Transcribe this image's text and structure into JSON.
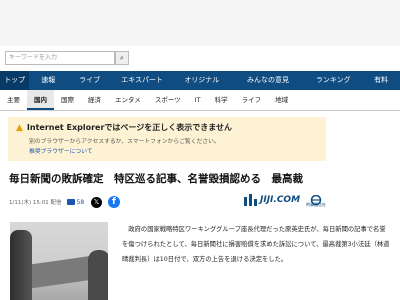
{
  "search": {
    "placeholder": "キーワードを入力",
    "button_icon": "search-icon"
  },
  "nav": {
    "items": [
      "トップ",
      "速報",
      "ライブ",
      "エキスパート",
      "オリジナル",
      "みんなの意見",
      "ランキング",
      "有料"
    ]
  },
  "subnav": {
    "items": [
      "主要",
      "国内",
      "国際",
      "経済",
      "エンタメ",
      "スポーツ",
      "IT",
      "科学",
      "ライフ",
      "地域"
    ],
    "active": "国内"
  },
  "ie_notice": {
    "title": "Internet Explorerではページを正しく表示できません",
    "message": "別のブラウザーからアクセスするか、スマートフォンからご覧ください。",
    "link": "推奨ブラウザーについて",
    "icon": "warning-icon",
    "icon_color": "#e5a000"
  },
  "article": {
    "title": "毎日新聞の敗訴確定　特区巡る記事、名誉毀損認める　最高裁",
    "date": "1/11(木) 15:01 配信",
    "comments": "58",
    "source": "JIJI.COM",
    "source_sub": "時事通信社",
    "body": "　政府の国家戦略特区ワーキンググループ座長代理だった原英史氏が、毎日新聞の記事で名誉を傷つけられたとして、毎日新聞社に損害賠償を求めた訴訟について、最高裁第3小法廷（林道晴裁判長）は10日付で、双方の上告を退ける決定をした。"
  },
  "colors": {
    "nav_bg": "#0f4c81",
    "notice_bg": "#fdf2d4",
    "link": "#1a55b0"
  }
}
